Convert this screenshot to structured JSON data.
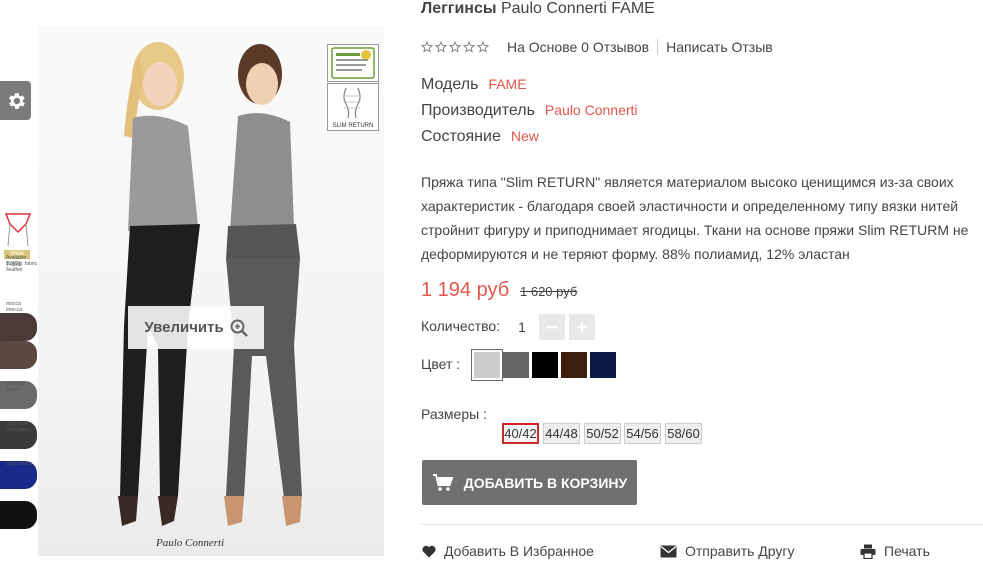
{
  "product": {
    "category": "Леггинсы",
    "name": "Paulo Connerti FAME"
  },
  "rating": {
    "stars": 0,
    "reviews_label": "На Основе 0 Отзывов",
    "write_review": "Написать Отзыв"
  },
  "meta": {
    "model_label": "Модель",
    "model_value": "FAME",
    "manufacturer_label": "Производитель",
    "manufacturer_value": "Paulo Connerti",
    "condition_label": "Состояние",
    "condition_value": "New"
  },
  "description": "Пряжа типа \"Slim RETURN\" является материалом высоко ценищимся из-за своих характеристик - благодаря своей эластичности и определенному типу вязки нитей стройнит фигуру и приподнимает ягодицы. Ткани на основе пряжи Slim RETURM не деформируются и не теряют форму. 88% полиамид, 12% эластан",
  "price": {
    "current": "1 194 руб",
    "old": "1 620 руб"
  },
  "quantity": {
    "label": "Количество:",
    "value": "1",
    "minus": "−",
    "plus": "+"
  },
  "colors": {
    "label": "Цвет :",
    "options": [
      "#cccccc",
      "#666666",
      "#000000",
      "#3d1f10",
      "#0e1a45"
    ],
    "selected": 0
  },
  "sizes": {
    "label": "Размеры :",
    "options": [
      "40/42",
      "44/48",
      "50/52",
      "54/56",
      "58/60"
    ],
    "selected": 0
  },
  "cart_button": "ДОБАВИТЬ В КОРЗИНУ",
  "actions": {
    "wishlist": "Добавить В Избранное",
    "send_friend": "Отправить Другу",
    "print": "Печать"
  },
  "gallery": {
    "zoom_label": "Увеличить",
    "brand_signature": "Paulo Connerti",
    "badge_slim": "SLIM RETURN",
    "wide_label": "Wide",
    "model_code": "T-371",
    "strip_swatches": [
      {
        "color": "#4a3b38",
        "text": "Available colours: fabric /leather"
      },
      {
        "color": "#5b4740",
        "text": "mocca /mocca"
      },
      {
        "color": "#6a6a6a",
        "text": "fumo /fumo"
      },
      {
        "color": "#3a3a3a",
        "text": "melange /black"
      },
      {
        "color": "#1a2a8a",
        "text": "navy blue /navy blue"
      },
      {
        "color": "#111111",
        "text": "black /black"
      }
    ]
  }
}
